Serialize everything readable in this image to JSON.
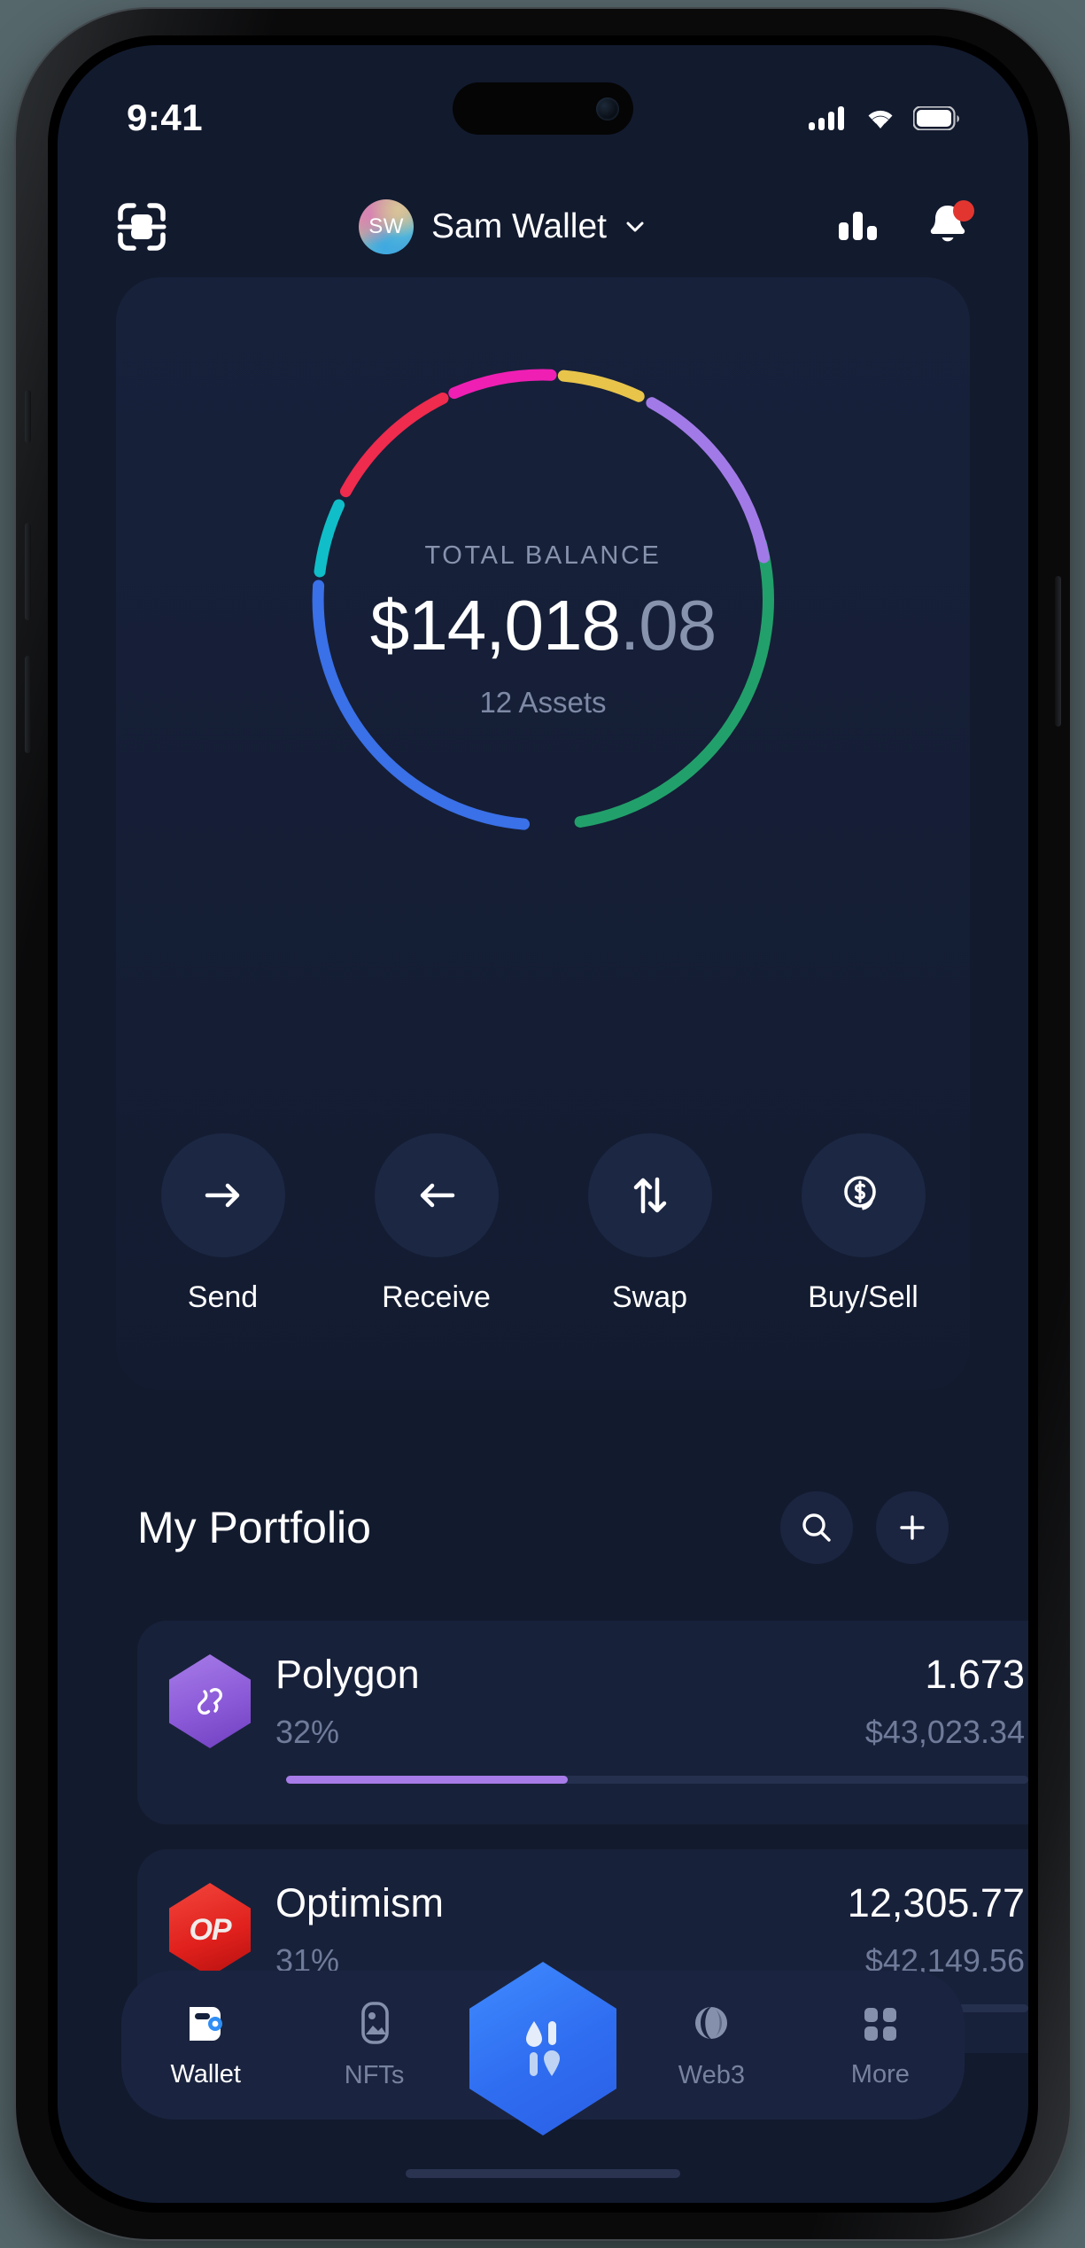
{
  "status_bar": {
    "time": "9:41",
    "icons": [
      "cellular-signal-icon",
      "wifi-icon",
      "battery-icon"
    ]
  },
  "header": {
    "scan_icon": "scan-face-icon",
    "avatar_initials": "SW",
    "wallet_name": "Sam Wallet",
    "chevron_icon": "chevron-down-icon",
    "chart_icon": "bar-chart-icon",
    "bell_icon": "bell-icon",
    "notification_dot_color": "#e3352f"
  },
  "balance": {
    "label": "TOTAL BALANCE",
    "amount": "$14,018",
    "cents": ".08",
    "assets_count": "12 Assets"
  },
  "actions": [
    {
      "label": "Send",
      "icon": "arrow-right-icon"
    },
    {
      "label": "Receive",
      "icon": "arrow-left-icon"
    },
    {
      "label": "Swap",
      "icon": "swap-vertical-arrows-icon"
    },
    {
      "label": "Buy/Sell",
      "icon": "dollar-coin-icon"
    }
  ],
  "portfolio": {
    "title": "My Portfolio",
    "search_icon": "search-icon",
    "add_icon": "plus-icon"
  },
  "assets": [
    {
      "name": "Polygon",
      "percent": "32%",
      "amount": "1.673",
      "value": "$43,023.34",
      "logo_text": "",
      "logo_icon": "polygon-logo-icon",
      "color": "#9a6ee0",
      "bar_color": "#a77ce8",
      "bar_pct": 38
    },
    {
      "name": "Optimism",
      "percent": "31%",
      "amount": "12,305.77",
      "value": "$42,149.56",
      "logo_text": "OP",
      "logo_icon": "optimism-logo-icon",
      "color": "#e8312a",
      "bar_color": "#e8312a",
      "bar_pct": 36
    }
  ],
  "tabs": [
    {
      "label": "Wallet",
      "icon": "wallet-icon",
      "active": true
    },
    {
      "label": "NFTs",
      "icon": "image-frame-icon",
      "active": false
    },
    {
      "label": "Web3",
      "icon": "globe-icon",
      "active": false
    },
    {
      "label": "More",
      "icon": "grid-squares-icon",
      "active": false
    }
  ],
  "fab": {
    "icon": "app-logo-icon"
  },
  "chart_data": {
    "type": "pie",
    "title": "TOTAL BALANCE",
    "categories": [
      "Green",
      "Purple",
      "Yellow",
      "Magenta",
      "Red",
      "Cyan",
      "Blue"
    ],
    "values": [
      24,
      17,
      5,
      7,
      9,
      6,
      22
    ],
    "colors": [
      "#22a06b",
      "#a27ae8",
      "#e8c44a",
      "#ef1fb4",
      "#ef2b4e",
      "#0fbec8",
      "#3a70e8"
    ],
    "total": "$14,018.08",
    "legend": "none",
    "ylabel": "",
    "xlabel": ""
  }
}
